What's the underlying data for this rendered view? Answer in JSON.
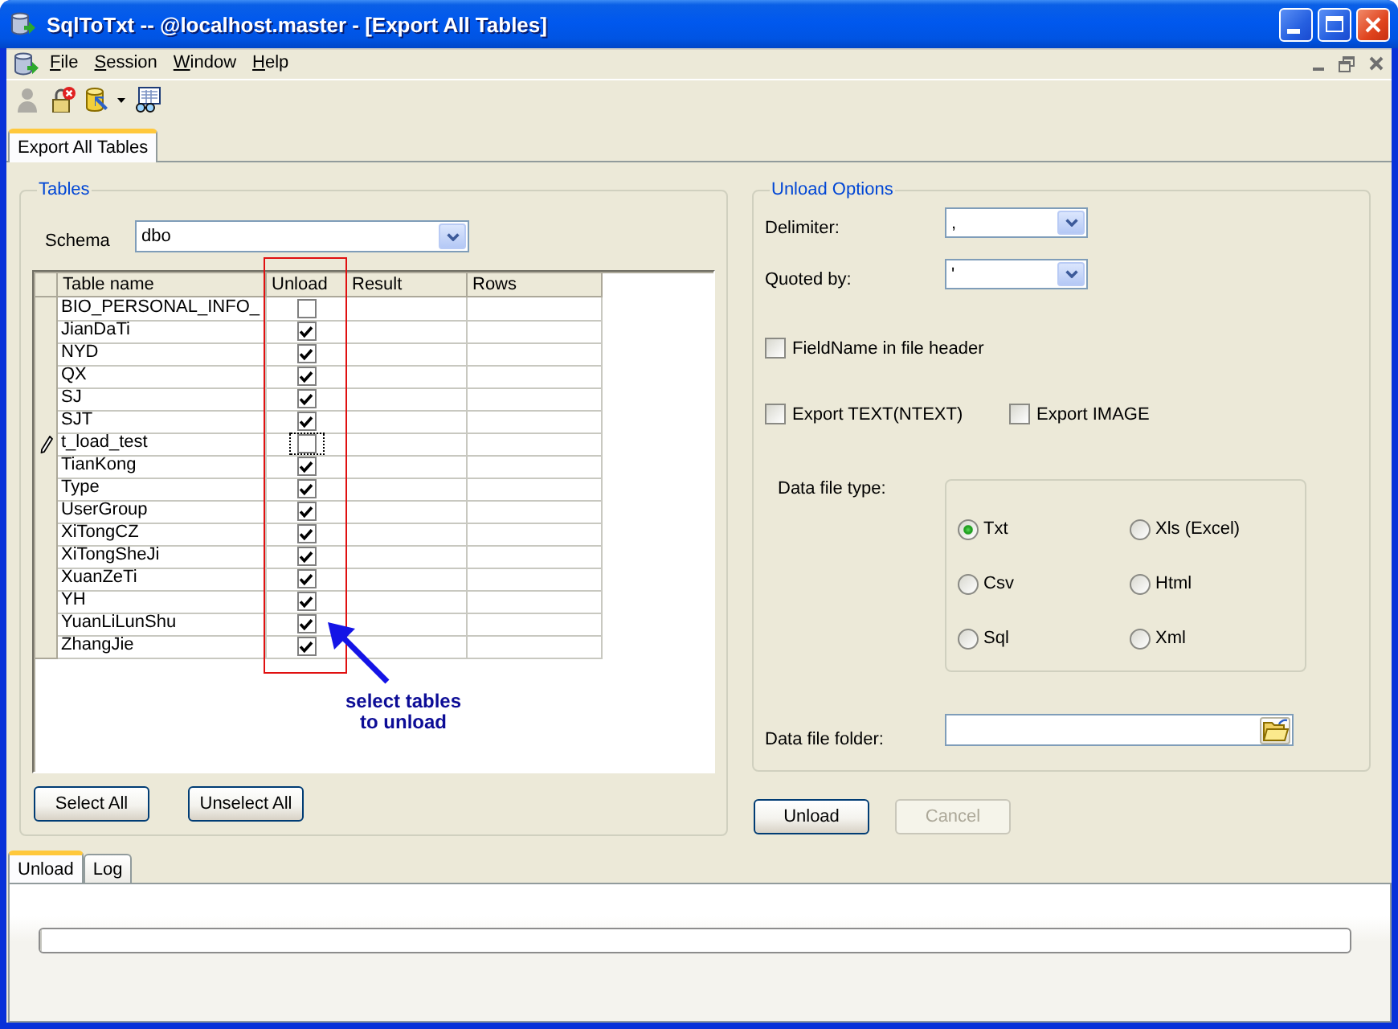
{
  "window": {
    "title": "SqlToTxt -- @localhost.master - [Export All Tables]"
  },
  "menu": [
    "File",
    "Session",
    "Window",
    "Help"
  ],
  "toolbar": [
    {
      "kind": "person",
      "disabled": true,
      "dropdown": false
    },
    {
      "kind": "lock",
      "disabled": false,
      "dropdown": false
    },
    {
      "kind": "database",
      "disabled": false,
      "dropdown": true
    },
    {
      "kind": "monitor",
      "disabled": false,
      "dropdown": false
    }
  ],
  "document_tabs": [
    {
      "label": "Export All Tables",
      "selected": true
    }
  ],
  "tables": {
    "title": "Tables",
    "schema": {
      "label": "Schema",
      "value": "dbo"
    },
    "columns": [
      "Table name",
      "Unload",
      "Result",
      "Rows"
    ],
    "rows": [
      {
        "name": "BIO_PERSONAL_INFO_",
        "unload": false,
        "editing": false
      },
      {
        "name": "JianDaTi",
        "unload": true,
        "editing": false
      },
      {
        "name": "NYD",
        "unload": true,
        "editing": false
      },
      {
        "name": "QX",
        "unload": true,
        "editing": false
      },
      {
        "name": "SJ",
        "unload": true,
        "editing": false
      },
      {
        "name": "SJT",
        "unload": true,
        "editing": false
      },
      {
        "name": "t_load_test",
        "unload": false,
        "editing": true
      },
      {
        "name": "TianKong",
        "unload": true,
        "editing": false
      },
      {
        "name": "Type",
        "unload": true,
        "editing": false
      },
      {
        "name": "UserGroup",
        "unload": true,
        "editing": false
      },
      {
        "name": "XiTongCZ",
        "unload": true,
        "editing": false
      },
      {
        "name": "XiTongSheJi",
        "unload": true,
        "editing": false
      },
      {
        "name": "XuanZeTi",
        "unload": true,
        "editing": false
      },
      {
        "name": "YH",
        "unload": true,
        "editing": false
      },
      {
        "name": "YuanLiLunShu",
        "unload": true,
        "editing": false
      },
      {
        "name": "ZhangJie",
        "unload": true,
        "editing": false
      }
    ],
    "annotation": "select tables\nto unload",
    "buttons": [
      "Select All",
      "Unselect All"
    ]
  },
  "unload_options": {
    "title": "Unload Options",
    "delimiter": {
      "label": "Delimiter:",
      "value": ","
    },
    "quoted_by": {
      "label": "Quoted by:",
      "value": "'"
    },
    "field_name_header": {
      "label": "FieldName in file header",
      "checked": false
    },
    "export_options": [
      {
        "label": "Export TEXT(NTEXT)",
        "checked": false
      },
      {
        "label": "Export IMAGE",
        "checked": false
      }
    ],
    "data_file_type": {
      "label": "Data file type:",
      "options": [
        {
          "label": "Txt",
          "selected": true
        },
        {
          "label": "Xls (Excel)",
          "selected": false
        },
        {
          "label": "Csv",
          "selected": false
        },
        {
          "label": "Html",
          "selected": false
        },
        {
          "label": "Sql",
          "selected": false
        },
        {
          "label": "Xml",
          "selected": false
        }
      ]
    },
    "data_file_folder": {
      "label": "Data file folder:"
    }
  },
  "actions": [
    {
      "label": "Unload",
      "disabled": false
    },
    {
      "label": "Cancel",
      "disabled": true
    }
  ],
  "bottom_tabs": [
    {
      "label": "Unload",
      "selected": true
    },
    {
      "label": "Log",
      "selected": false
    }
  ],
  "progress": {
    "level": 0
  }
}
